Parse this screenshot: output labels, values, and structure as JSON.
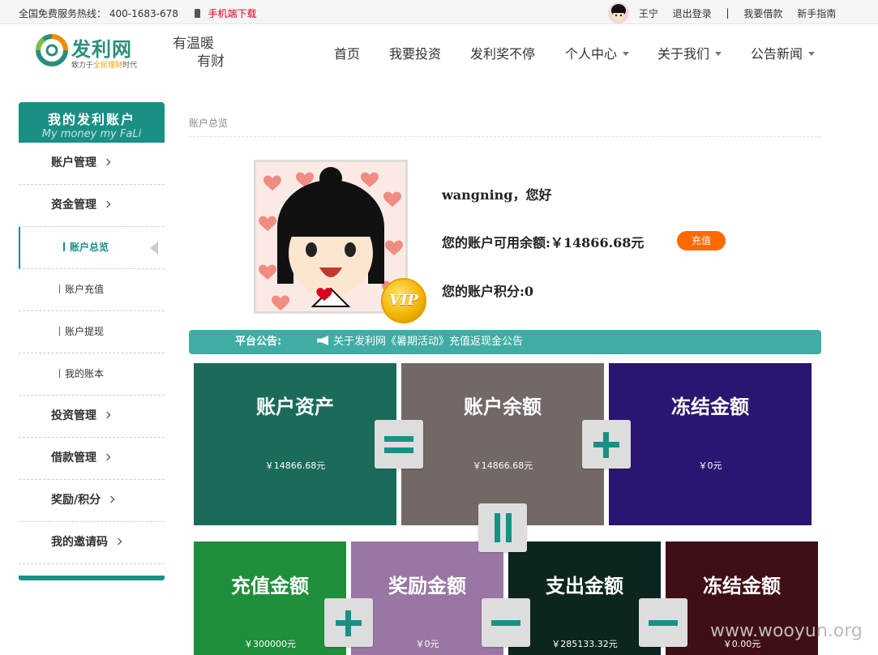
{
  "topbar": {
    "hotline_label": "全国免费服务热线：",
    "hotline_number": "400-1683-678",
    "mobile_download": "手机端下载",
    "username": "王宁",
    "logout": "退出登录",
    "separator": "|",
    "borrow": "我要借款",
    "guide": "新手指南"
  },
  "header": {
    "logo_title": "发利网",
    "logo_sub_pre": "致力于",
    "logo_sub_em": "全民理财",
    "logo_sub_post": "时代",
    "slogan_1": "有温暖",
    "slogan_2": "有财",
    "nav": [
      "首页",
      "我要投资",
      "发利奖不停",
      "个人中心",
      "关于我们",
      "公告新闻"
    ]
  },
  "sidebar": {
    "title": "我的发利账户",
    "subtitle": "My money my FaLi",
    "items": {
      "account": "账户管理",
      "funds": "资金管理",
      "overview": "账户总览",
      "recharge": "账户充值",
      "withdraw": "账户提现",
      "ledger": "我的账本",
      "invest": "投资管理",
      "loan": "借款管理",
      "reward": "奖励/积分",
      "invite": "我的邀请码"
    }
  },
  "main": {
    "breadcrumb": "账户总览",
    "vip": "VIP",
    "greeting": "wangning，您好",
    "balance_text": "您的账户可用余额:￥14866.68元",
    "recharge_button": "充值",
    "points_text": "您的账户积分:0",
    "notice_label": "平台公告:",
    "notice_text": "关于发利网《暑期活动》充值返现金公告"
  },
  "summary_boxes": {
    "assets": {
      "title": "账户资产",
      "amount": "￥14866.68元",
      "color": "#1a6b5a"
    },
    "balance": {
      "title": "账户余额",
      "amount": "￥14866.68元",
      "color": "#726866"
    },
    "frozen": {
      "title": "冻结金额",
      "amount": "￥0元",
      "color": "#2a1670"
    },
    "recharge": {
      "title": "充值金额",
      "amount": "￥300000元",
      "color": "#1e8f3a"
    },
    "reward": {
      "title": "奖励金额",
      "amount": "￥0元",
      "color": "#9a76a4"
    },
    "expense": {
      "title": "支出金额",
      "amount": "￥285133.32元",
      "color": "#0b2620"
    },
    "frozen2": {
      "title": "冻结金额",
      "amount": "￥0.00元",
      "color": "#400f14"
    }
  },
  "watermark": "www.wooyun.org"
}
